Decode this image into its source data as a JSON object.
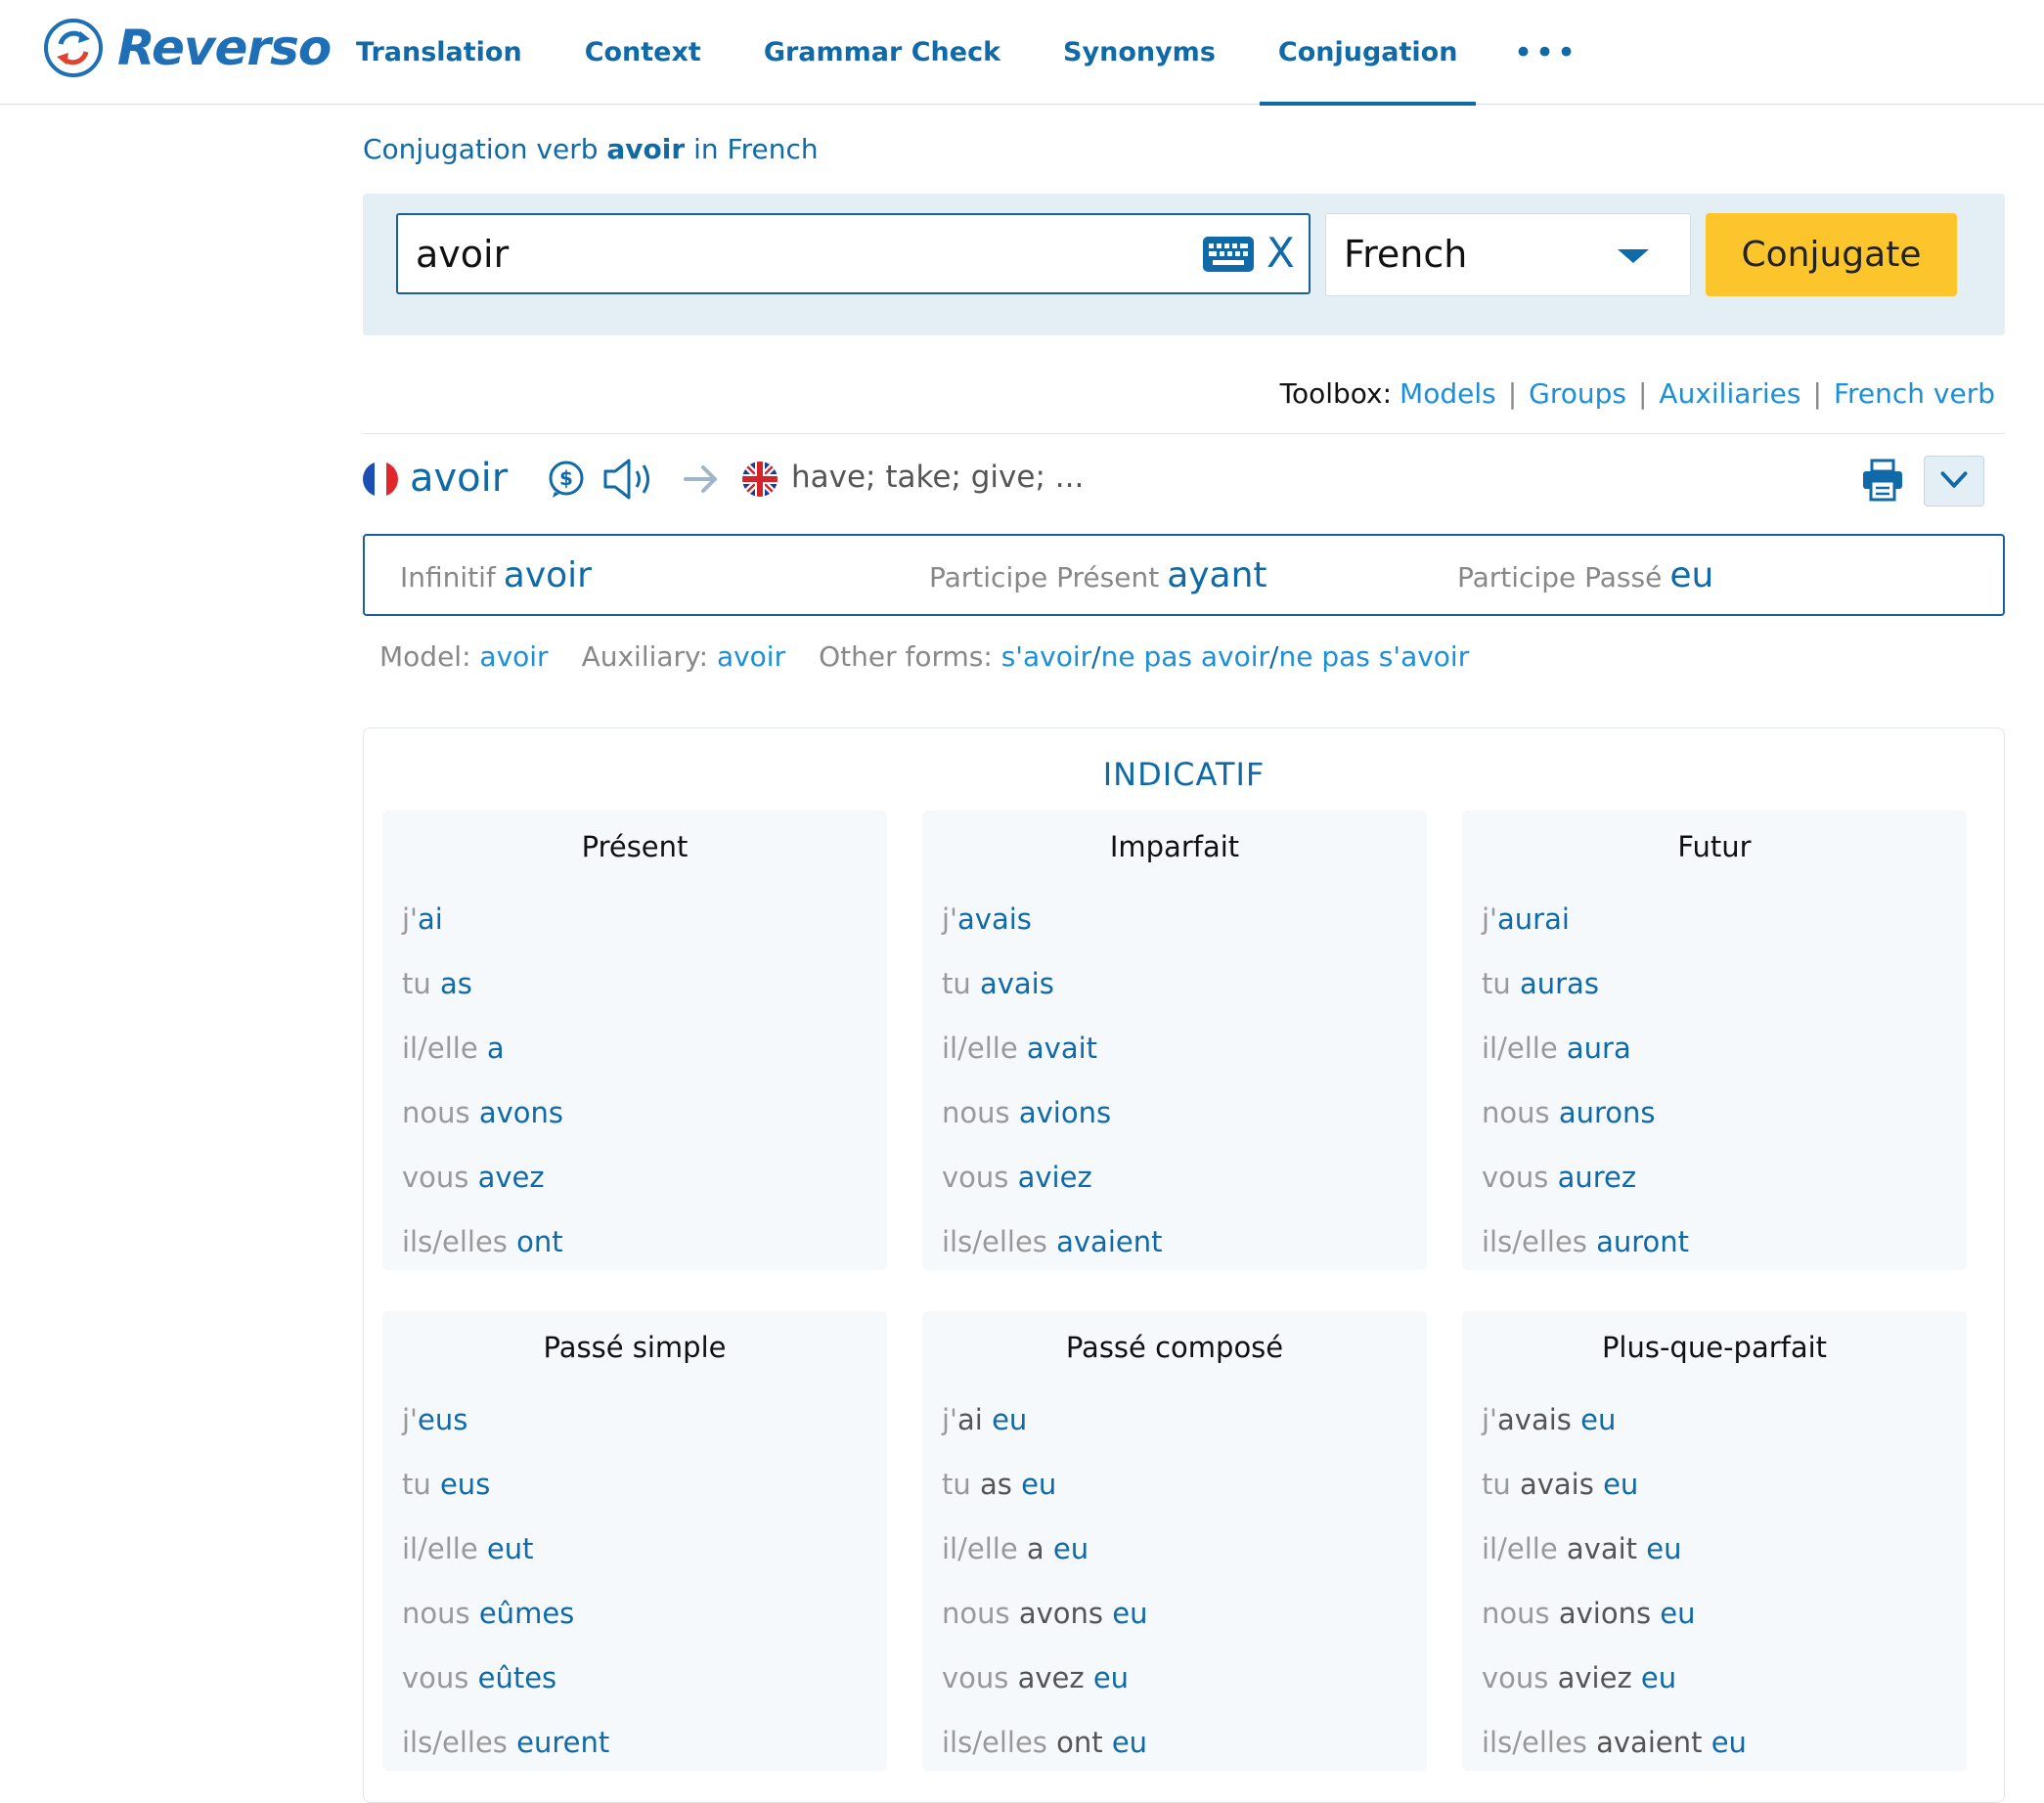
{
  "brand": {
    "name": "Reverso"
  },
  "nav": [
    {
      "label": "Translation",
      "active": false
    },
    {
      "label": "Context",
      "active": false
    },
    {
      "label": "Grammar Check",
      "active": false
    },
    {
      "label": "Synonyms",
      "active": false
    },
    {
      "label": "Conjugation",
      "active": true
    }
  ],
  "nav_more": "•••",
  "page_title": {
    "prefix": "Conjugation verb ",
    "verb": "avoir",
    "suffix": " in French"
  },
  "search": {
    "value": "avoir",
    "clear_label": "X",
    "language": "French",
    "button_label": "Conjugate"
  },
  "toolbox": {
    "label": "Toolbox:",
    "links": [
      "Models",
      "Groups",
      "Auxiliaries",
      "French verb"
    ]
  },
  "verb_header": {
    "verb": "avoir",
    "translation": "have; take; give; ...",
    "icons": [
      "fr-flag-icon",
      "speak-slow-icon",
      "speaker-icon",
      "arrow-right-icon",
      "uk-flag-icon",
      "print-icon",
      "chevron-down-icon"
    ]
  },
  "forms": {
    "infinitif_label": "Infinitif",
    "infinitif_value": "avoir",
    "participe_present_label": "Participe Présent",
    "participe_present_value": "ayant",
    "participe_passe_label": "Participe Passé",
    "participe_passe_value": "eu"
  },
  "meta": {
    "model_label": "Model:",
    "model_value": "avoir",
    "auxiliary_label": "Auxiliary:",
    "auxiliary_value": "avoir",
    "other_forms_label": "Other forms:",
    "other_forms": [
      "s'avoir",
      "ne pas avoir",
      "ne pas s'avoir"
    ],
    "slash": "/"
  },
  "mood": "INDICATIF",
  "tenses": [
    {
      "name": "Présent",
      "rows": [
        {
          "pron": "j'",
          "aux": "",
          "verb": "ai"
        },
        {
          "pron": "tu ",
          "aux": "",
          "verb": "as"
        },
        {
          "pron": "il/elle ",
          "aux": "",
          "verb": "a"
        },
        {
          "pron": "nous ",
          "aux": "",
          "verb": "avons"
        },
        {
          "pron": "vous ",
          "aux": "",
          "verb": "avez"
        },
        {
          "pron": "ils/elles ",
          "aux": "",
          "verb": "ont"
        }
      ]
    },
    {
      "name": "Imparfait",
      "rows": [
        {
          "pron": "j'",
          "aux": "",
          "verb": "avais"
        },
        {
          "pron": "tu ",
          "aux": "",
          "verb": "avais"
        },
        {
          "pron": "il/elle ",
          "aux": "",
          "verb": "avait"
        },
        {
          "pron": "nous ",
          "aux": "",
          "verb": "avions"
        },
        {
          "pron": "vous ",
          "aux": "",
          "verb": "aviez"
        },
        {
          "pron": "ils/elles ",
          "aux": "",
          "verb": "avaient"
        }
      ]
    },
    {
      "name": "Futur",
      "rows": [
        {
          "pron": "j'",
          "aux": "",
          "verb": "aurai"
        },
        {
          "pron": "tu ",
          "aux": "",
          "verb": "auras"
        },
        {
          "pron": "il/elle ",
          "aux": "",
          "verb": "aura"
        },
        {
          "pron": "nous ",
          "aux": "",
          "verb": "aurons"
        },
        {
          "pron": "vous ",
          "aux": "",
          "verb": "aurez"
        },
        {
          "pron": "ils/elles ",
          "aux": "",
          "verb": "auront"
        }
      ]
    },
    {
      "name": "Passé simple",
      "rows": [
        {
          "pron": "j'",
          "aux": "",
          "verb": "eus"
        },
        {
          "pron": "tu ",
          "aux": "",
          "verb": "eus"
        },
        {
          "pron": "il/elle ",
          "aux": "",
          "verb": "eut"
        },
        {
          "pron": "nous ",
          "aux": "",
          "verb": "eûmes"
        },
        {
          "pron": "vous ",
          "aux": "",
          "verb": "eûtes"
        },
        {
          "pron": "ils/elles ",
          "aux": "",
          "verb": "eurent"
        }
      ]
    },
    {
      "name": "Passé composé",
      "rows": [
        {
          "pron": "j'",
          "aux": "ai ",
          "verb": "eu"
        },
        {
          "pron": "tu ",
          "aux": "as ",
          "verb": "eu"
        },
        {
          "pron": "il/elle ",
          "aux": "a ",
          "verb": "eu"
        },
        {
          "pron": "nous ",
          "aux": "avons ",
          "verb": "eu"
        },
        {
          "pron": "vous ",
          "aux": "avez ",
          "verb": "eu"
        },
        {
          "pron": "ils/elles ",
          "aux": "ont ",
          "verb": "eu"
        }
      ]
    },
    {
      "name": "Plus-que-parfait",
      "rows": [
        {
          "pron": "j'",
          "aux": "avais ",
          "verb": "eu"
        },
        {
          "pron": "tu ",
          "aux": "avais ",
          "verb": "eu"
        },
        {
          "pron": "il/elle ",
          "aux": "avait ",
          "verb": "eu"
        },
        {
          "pron": "nous ",
          "aux": "avions ",
          "verb": "eu"
        },
        {
          "pron": "vous ",
          "aux": "aviez ",
          "verb": "eu"
        },
        {
          "pron": "ils/elles ",
          "aux": "avaient ",
          "verb": "eu"
        }
      ]
    }
  ],
  "colors": {
    "brand_blue": "#106aa8",
    "link_blue": "#1d8ed8",
    "button_yellow": "#fdc52c",
    "panel_bg": "#e4eef5"
  }
}
